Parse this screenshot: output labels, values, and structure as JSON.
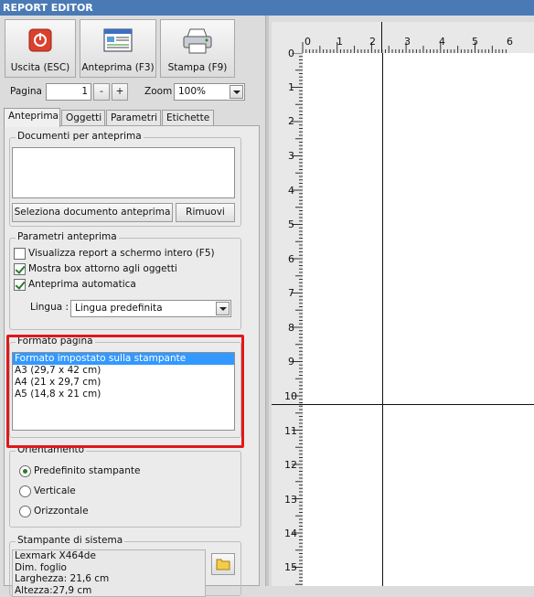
{
  "app": {
    "title": "REPORT EDITOR"
  },
  "toolbar": {
    "exit_label": "Uscita (ESC)",
    "preview_label": "Anteprima (F3)",
    "print_label": "Stampa (F9)"
  },
  "page": {
    "label": "Pagina",
    "value": "1",
    "minus": "-",
    "plus": "+"
  },
  "zoom": {
    "label": "Zoom",
    "value": "100%"
  },
  "tabs": [
    "Anteprima",
    "Oggetti",
    "Parametri",
    "Etichette"
  ],
  "docs": {
    "title": "Documenti per anteprima",
    "select_button": "Seleziona documento anteprima",
    "remove_button": "Rimuovi"
  },
  "preview_params": {
    "title": "Parametri anteprima",
    "fullscreen": {
      "label": "Visualizza report a schermo intero (F5)",
      "checked": false
    },
    "show_box": {
      "label": "Mostra box attorno agli oggetti",
      "checked": true
    },
    "auto_preview": {
      "label": "Anteprima automatica",
      "checked": true
    },
    "language_label": "Lingua :",
    "language_value": "Lingua predefinita"
  },
  "page_format": {
    "title": "Formato pagina",
    "options": [
      "Formato impostato sulla stampante",
      "A3 (29,7 x 42 cm)",
      "A4 (21 x 29,7 cm)",
      "A5 (14,8 x 21 cm)"
    ],
    "selected_index": 0
  },
  "orientation": {
    "title": "Orientamento",
    "options": [
      "Predefinito stampante",
      "Verticale",
      "Orizzontale"
    ],
    "selected_index": 0
  },
  "system_printers": {
    "title": "Stampante di sistema",
    "lines": [
      "Lexmark X464de",
      "Dim. foglio",
      "Larghezza: 21,6 cm",
      "Altezza:27,9 cm"
    ]
  },
  "ruler": {
    "horizontal": [
      "0",
      "1",
      "2",
      "3",
      "4",
      "5",
      "6"
    ],
    "vertical": [
      "0",
      "1",
      "2",
      "3",
      "4",
      "5",
      "6",
      "7",
      "8",
      "9",
      "10",
      "11",
      "12",
      "13",
      "14",
      "15"
    ]
  },
  "colors": {
    "titlebar": "#4a7ab5",
    "selection": "#3399ff",
    "highlight": "#e0181b"
  }
}
